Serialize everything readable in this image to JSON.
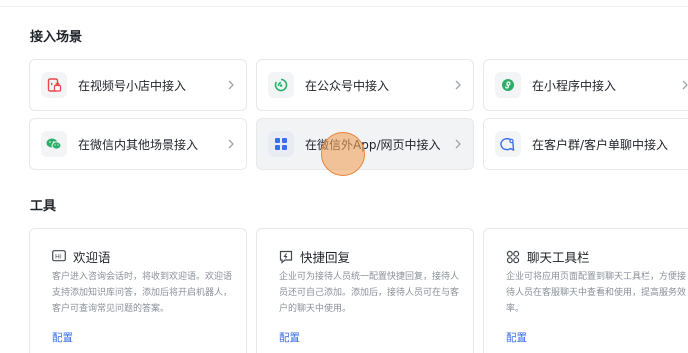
{
  "sections": {
    "access_title": "接入场景",
    "tools_title": "工具"
  },
  "access_cards": [
    {
      "label": "在视频号小店中接入",
      "icon": "shop-icon"
    },
    {
      "label": "在公众号中接入",
      "icon": "official-account-icon"
    },
    {
      "label": "在小程序中接入",
      "icon": "mini-program-icon"
    },
    {
      "label": "在微信内其他场景接入",
      "icon": "wechat-icon"
    },
    {
      "label": "在微信外App/网页中接入",
      "icon": "app-grid-icon"
    },
    {
      "label": "在客户群/客户单聊中接入",
      "icon": "customer-group-icon"
    }
  ],
  "tools": [
    {
      "name": "欢迎语",
      "desc": "客户进入咨询会话时，将收到欢迎语。欢迎语支持添加知识库问答，添加后将开启机器人，客户可查询常见问题的答案。",
      "action": "配置",
      "icon": "hi-icon"
    },
    {
      "name": "快捷回复",
      "desc": "企业可为接待人员统一配置快捷回复，接待人员还可自己添加。添加后，接待人员可在与客户的聊天中使用。",
      "action": "配置",
      "icon": "quick-reply-icon"
    },
    {
      "name": "聊天工具栏",
      "desc": "企业可将应用页面配置到聊天工具栏，方便接待人员在客服聊天中查看和使用，提高服务效率。",
      "action": "配置",
      "icon": "toolbar-icon"
    }
  ],
  "colors": {
    "green": "#2bae67",
    "red": "#e5484d",
    "blue": "#3a6ee8",
    "text": "#1f2329",
    "muted": "#8a9099"
  }
}
